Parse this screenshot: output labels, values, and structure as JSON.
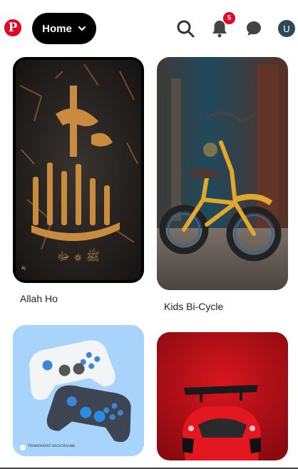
{
  "header": {
    "logo_glyph": "P",
    "home_label": "Home",
    "notification_count": "5",
    "avatar_initial": "U"
  },
  "pins": [
    {
      "title": "Allah Ho",
      "watermark": "AJ"
    },
    {
      "title": "Kids Bi-Cycle"
    },
    {
      "title": "",
      "watermark": "TRANSPARENT BACKGROUND"
    },
    {
      "title": ""
    }
  ],
  "colors": {
    "brand": "#e60023",
    "pill": "#000000",
    "avatar": "#2f4858"
  }
}
